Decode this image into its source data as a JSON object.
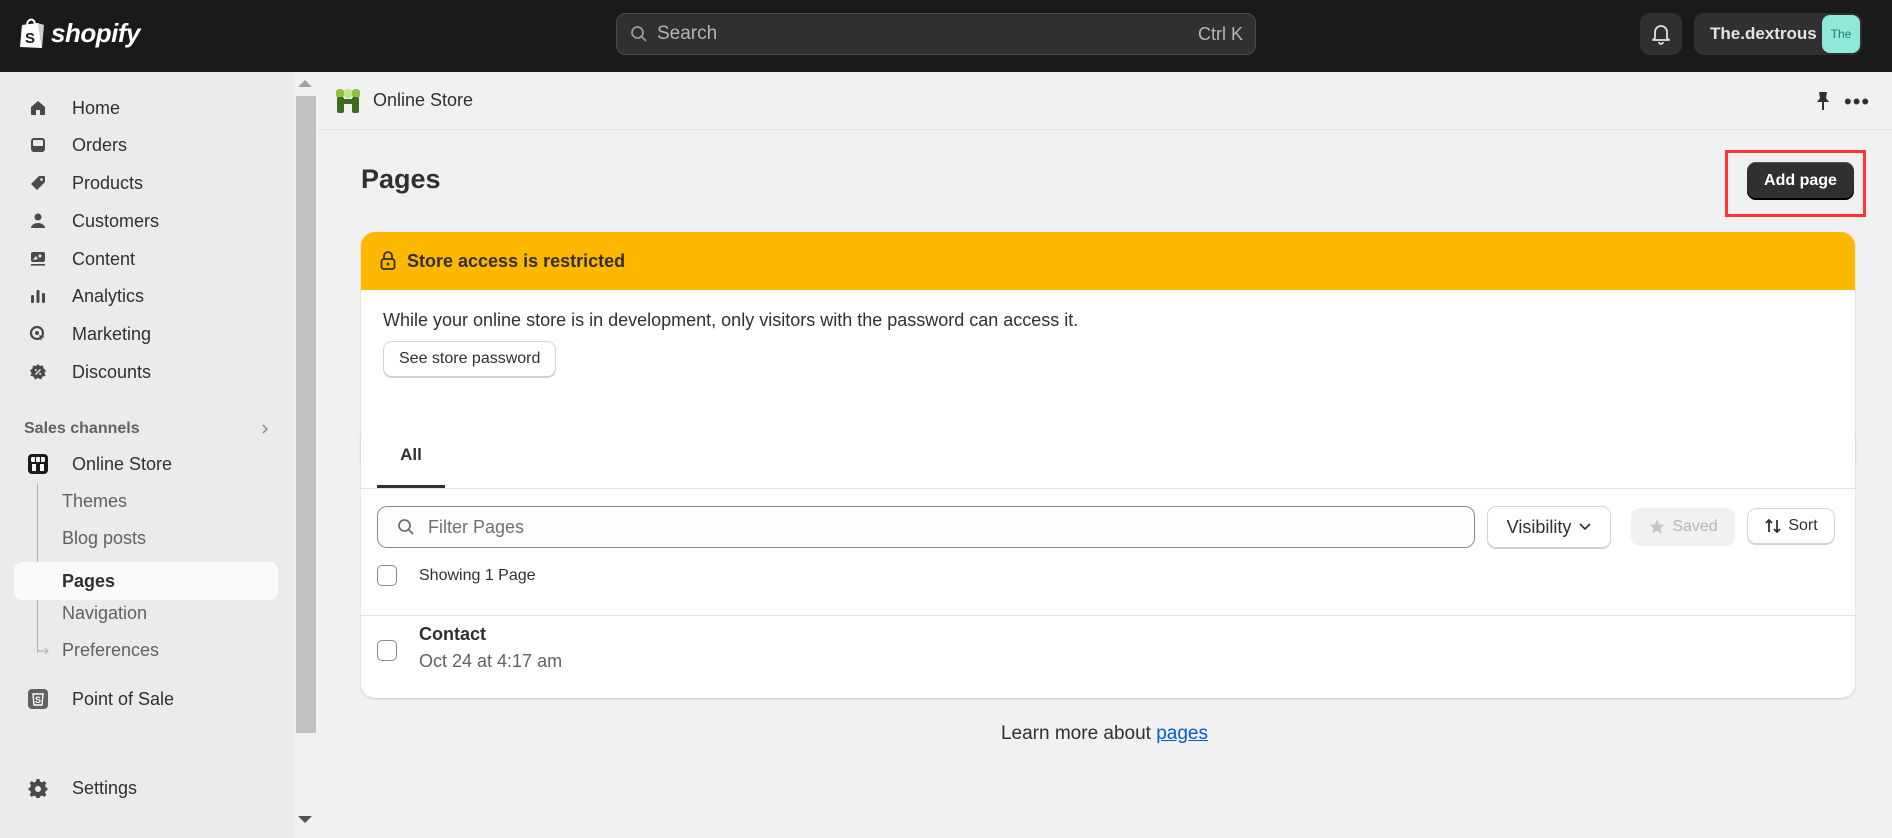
{
  "topbar": {
    "brand": "shopify",
    "search_placeholder": "Search",
    "search_shortcut": "Ctrl K",
    "user_name": "The.dextrous",
    "avatar_initials": "The"
  },
  "sidebar": {
    "items": [
      {
        "label": "Home",
        "icon": "home-icon"
      },
      {
        "label": "Orders",
        "icon": "inbox-icon"
      },
      {
        "label": "Products",
        "icon": "tag-icon"
      },
      {
        "label": "Customers",
        "icon": "person-icon"
      },
      {
        "label": "Content",
        "icon": "image-icon"
      },
      {
        "label": "Analytics",
        "icon": "bar-chart-icon"
      },
      {
        "label": "Marketing",
        "icon": "target-icon"
      },
      {
        "label": "Discounts",
        "icon": "discount-icon"
      }
    ],
    "sales_channels_label": "Sales channels",
    "online_store": {
      "label": "Online Store",
      "subitems": [
        {
          "label": "Themes",
          "active": false
        },
        {
          "label": "Blog posts",
          "active": false
        },
        {
          "label": "Pages",
          "active": true
        },
        {
          "label": "Navigation",
          "active": false
        },
        {
          "label": "Preferences",
          "active": false
        }
      ]
    },
    "point_of_sale": "Point of Sale",
    "settings": "Settings"
  },
  "appbar": {
    "title": "Online Store"
  },
  "page": {
    "title": "Pages",
    "add_button": "Add page"
  },
  "banner": {
    "title": "Store access is restricted",
    "text": "While your online store is in development, only visitors with the password can access it.",
    "button": "See store password",
    "color": "#ffb800"
  },
  "list": {
    "tabs": [
      {
        "label": "All",
        "selected": true
      }
    ],
    "filter_placeholder": "Filter Pages",
    "visibility_label": "Visibility",
    "saved_label": "Saved",
    "sort_label": "Sort",
    "showing_label": "Showing 1 Page",
    "rows": [
      {
        "title": "Contact",
        "date": "Oct 24 at 4:17 am"
      }
    ]
  },
  "footer": {
    "learn_prefix": "Learn more about ",
    "learn_link": "pages"
  }
}
